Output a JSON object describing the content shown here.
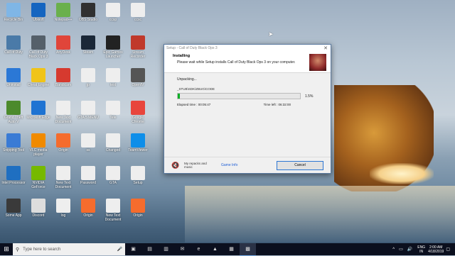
{
  "desktop": {
    "icons": [
      {
        "label": "Recycle Bin",
        "icon": "recycle-bin-icon",
        "color": "#7fb6e6"
      },
      {
        "label": "Ubisoft",
        "icon": "blue-app-icon",
        "color": "#1565c0"
      },
      {
        "label": "Notepad++",
        "icon": "notepad-plus-icon",
        "color": "#6ab04c"
      },
      {
        "label": "OBS Studio",
        "icon": "obs-icon",
        "color": "#303030"
      },
      {
        "label": "ccsp",
        "icon": "file-icon",
        "color": "#eeeeee"
      },
      {
        "label": "ccsc",
        "icon": "file-icon",
        "color": "#eeeeee"
      },
      {
        "label": "Call of Duty",
        "icon": "game-shortcut-icon",
        "color": "#4a7aa8"
      },
      {
        "label": "Call of Duty Black Ops 3",
        "icon": "game-shortcut-icon",
        "color": "#55606a"
      },
      {
        "label": "AnyDesk",
        "icon": "anydesk-icon",
        "color": "#e0453a"
      },
      {
        "label": "Steam",
        "icon": "steam-icon",
        "color": "#1b2838"
      },
      {
        "label": "Epic Games Launcher",
        "icon": "epic-games-icon",
        "color": "#222222"
      },
      {
        "label": "Stream Recorder",
        "icon": "recorder-icon",
        "color": "#c0392b"
      },
      {
        "label": "Uninstall",
        "icon": "uninstall-icon",
        "color": "#2b78d6"
      },
      {
        "label": "Cheat Engine",
        "icon": "cheat-engine-icon",
        "color": "#f0c419"
      },
      {
        "label": "Bandicam",
        "icon": "bandicam-icon",
        "color": "#d63a2f"
      },
      {
        "label": "jp",
        "icon": "file-icon",
        "color": "#eeeeee"
      },
      {
        "label": "test",
        "icon": "file-icon",
        "color": "#eeeeee"
      },
      {
        "label": "OpenIV",
        "icon": "openiv-icon",
        "color": "#555555"
      },
      {
        "label": "Grand Theft Auto V",
        "icon": "gta-icon",
        "color": "#4c8a2c"
      },
      {
        "label": "Microsoft Edge",
        "icon": "edge-icon",
        "color": "#1e73d2"
      },
      {
        "label": "New Text Document",
        "icon": "file-icon",
        "color": "#eeeeee"
      },
      {
        "label": "GTA 5 MENU",
        "icon": "file-icon",
        "color": "#eeeeee"
      },
      {
        "label": "Tele",
        "icon": "file-icon",
        "color": "#eeeeee"
      },
      {
        "label": "Google Chrome",
        "icon": "chrome-icon",
        "color": "#e8453c"
      },
      {
        "label": "Snipping Tool",
        "icon": "scissors-icon",
        "color": "#3a7bd5"
      },
      {
        "label": "VLC media player",
        "icon": "vlc-icon",
        "color": "#f08a00"
      },
      {
        "label": "Origin",
        "icon": "origin-icon",
        "color": "#f56c2d"
      },
      {
        "label": "ss",
        "icon": "file-icon",
        "color": "#eeeeee"
      },
      {
        "label": "Changed",
        "icon": "file-icon",
        "color": "#eeeeee"
      },
      {
        "label": "TeamViewer",
        "icon": "teamviewer-icon",
        "color": "#0e8ee9"
      },
      {
        "label": "Intel Processor",
        "icon": "intel-icon",
        "color": "#1f6fc1"
      },
      {
        "label": "NVIDIA GeForce",
        "icon": "nvidia-icon",
        "color": "#76b900"
      },
      {
        "label": "New Text Document",
        "icon": "file-icon",
        "color": "#eeeeee"
      },
      {
        "label": "Password",
        "icon": "file-icon",
        "color": "#eeeeee"
      },
      {
        "label": "GTA",
        "icon": "file-icon",
        "color": "#eeeeee"
      },
      {
        "label": "Setup",
        "icon": "file-icon",
        "color": "#eeeeee"
      },
      {
        "label": "Some App",
        "icon": "app-icon",
        "color": "#3a3a3a"
      },
      {
        "label": "Discord",
        "icon": "app-icon",
        "color": "#dddddd"
      },
      {
        "label": "log",
        "icon": "file-icon",
        "color": "#eeeeee"
      },
      {
        "label": "Origin",
        "icon": "origin-icon",
        "color": "#f56c2d"
      },
      {
        "label": "New Text Document",
        "icon": "file-icon",
        "color": "#eeeeee"
      },
      {
        "label": "Origin",
        "icon": "origin-icon",
        "color": "#f56c2d"
      }
    ]
  },
  "setup": {
    "title": "Setup - Call of Duty Black Ops 3",
    "heading": "Installing",
    "subheading": "Please wait while Setup installs Call of Duty Black Ops 3 on your computer.",
    "status": "Unpacking...",
    "file": "_STUB\\SDK\\ZBUG\\CODE",
    "progress_percent": 1.5,
    "progress_label": "1.5%",
    "elapsed_label": "Elapsed time : 00:05:47",
    "timeleft_label": "Time left : 06:32:00",
    "repacks_label": "My repacks and music",
    "game_info_label": "Game Info",
    "cancel_label": "Cancel"
  },
  "taskbar": {
    "search_placeholder": "Type here to search",
    "apps": [
      "task-view-icon",
      "file-explorer-icon",
      "store-icon",
      "mail-icon",
      "edge-icon",
      "vlc-icon",
      "photos-icon",
      "setup-icon"
    ],
    "lang_top": "ENG",
    "lang_bottom": "IN",
    "time": "2:00 AM",
    "date": "4/18/2019"
  }
}
